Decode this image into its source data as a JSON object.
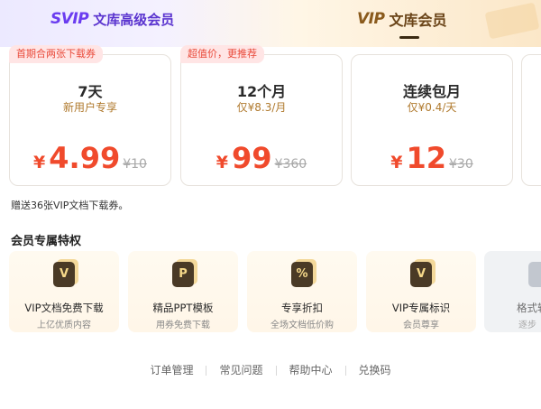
{
  "tabs": [
    {
      "logo": "SVIP",
      "label": "文库高级会员"
    },
    {
      "logo": "VIP",
      "label": "文库会员"
    }
  ],
  "plans": [
    {
      "badge": "首期合两张下载券",
      "title": "7天",
      "subtitle": "新用户专享",
      "currency": "¥",
      "price": "4.99",
      "original": "¥10"
    },
    {
      "badge": "超值价，更推荐",
      "title": "12个月",
      "subtitle": "仅¥8.3/月",
      "currency": "¥",
      "price": "99",
      "original": "¥360"
    },
    {
      "badge": "",
      "title": "连续包月",
      "subtitle": "仅¥0.4/天",
      "currency": "¥",
      "price": "12",
      "original": "¥30"
    }
  ],
  "gift_note": "赠送36张VIP文档下载券。",
  "privileges_title": "会员专属特权",
  "privileges": [
    {
      "icon": "v-icon",
      "glyph": "V",
      "title": "VIP文档免费下载",
      "desc": "上亿优质内容"
    },
    {
      "icon": "ppt-icon",
      "glyph": "P",
      "title": "精品PPT模板",
      "desc": "用券免费下载"
    },
    {
      "icon": "discount-icon",
      "glyph": "%",
      "title": "专享折扣",
      "desc": "全场文档低价购"
    },
    {
      "icon": "vip-badge-icon",
      "glyph": "V",
      "title": "VIP专属标识",
      "desc": "会员尊享"
    },
    {
      "icon": "convert-icon",
      "glyph": "",
      "title": "格式转",
      "desc": "逐步"
    }
  ],
  "footer_links": [
    "订单管理",
    "常见问题",
    "帮助中心",
    "兑换码"
  ],
  "colors": {
    "accent_price": "#f04a2c",
    "svip_purple": "#6a3cf0",
    "vip_gold": "#8a5a1c"
  }
}
